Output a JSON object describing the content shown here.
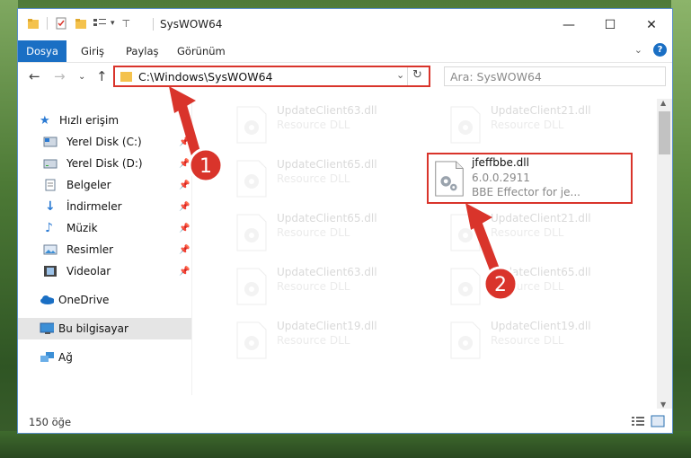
{
  "window": {
    "title": "SysWOW64",
    "controls": {
      "minimize": "—",
      "maximize": "☐",
      "close": "✕"
    }
  },
  "ribbon": {
    "tabs": [
      "Dosya",
      "Giriş",
      "Paylaş",
      "Görünüm"
    ],
    "help": "?"
  },
  "navigation": {
    "address_path": "C:\\Windows\\SysWOW64",
    "search_placeholder": "Ara: SysWOW64"
  },
  "sidebar": {
    "items": [
      {
        "label": "Hızlı erişim",
        "icon": "star-icon",
        "pinned": false
      },
      {
        "label": "Yerel Disk (C:)",
        "icon": "drive-icon",
        "pinned": true
      },
      {
        "label": "Yerel Disk (D:)",
        "icon": "drive-icon",
        "pinned": true
      },
      {
        "label": "Belgeler",
        "icon": "documents-icon",
        "pinned": true
      },
      {
        "label": "İndirmeler",
        "icon": "download-icon",
        "pinned": true
      },
      {
        "label": "Müzik",
        "icon": "music-icon",
        "pinned": true
      },
      {
        "label": "Resimler",
        "icon": "pictures-icon",
        "pinned": true
      },
      {
        "label": "Videolar",
        "icon": "videos-icon",
        "pinned": true
      },
      {
        "label": "OneDrive",
        "icon": "cloud-icon",
        "pinned": false
      },
      {
        "label": "Bu bilgisayar",
        "icon": "computer-icon",
        "pinned": false,
        "selected": true
      },
      {
        "label": "Ağ",
        "icon": "network-icon",
        "pinned": false
      }
    ]
  },
  "files": [
    {
      "name": "UpdateClient63.dll",
      "type": "Resource DLL",
      "faded": true
    },
    {
      "name": "UpdateClient21.dll",
      "type": "Resource DLL",
      "faded": true
    },
    {
      "name": "UpdateClient65.dll",
      "type": "Resource DLL",
      "faded": true
    },
    {
      "name": "jfeffbbe.dll",
      "version": "6.0.0.2911",
      "description": "BBE Effector for je...",
      "faded": false,
      "highlighted": true
    },
    {
      "name": "UpdateClient65.dll",
      "type": "Resource DLL",
      "faded": true
    },
    {
      "name": "UpdateClient21.dll",
      "type": "Resource DLL",
      "faded": true
    },
    {
      "name": "UpdateClient63.dll",
      "type": "Resource DLL",
      "faded": true
    },
    {
      "name": "UpdateClient65.dll",
      "type": "Resource DLL",
      "faded": true
    },
    {
      "name": "UpdateClient19.dll",
      "type": "Resource DLL",
      "faded": true
    },
    {
      "name": "UpdateClient19.dll",
      "type": "Resource DLL",
      "faded": true
    }
  ],
  "status": {
    "item_count": "150 öğe"
  },
  "annotations": {
    "step1": "1",
    "step2": "2",
    "color": "#d9342b"
  }
}
